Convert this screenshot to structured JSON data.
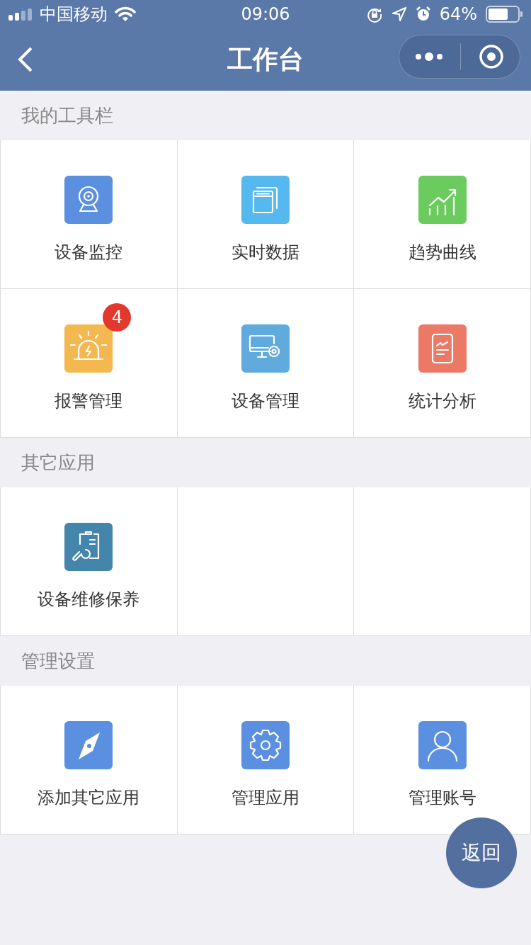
{
  "status_bar": {
    "carrier": "中国移动",
    "time": "09:06",
    "battery": "64%"
  },
  "nav": {
    "title": "工作台"
  },
  "sections": [
    {
      "title": "我的工具栏",
      "items": [
        {
          "label": "设备监控",
          "color": "#5b8fe0"
        },
        {
          "label": "实时数据",
          "color": "#55b8ee"
        },
        {
          "label": "趋势曲线",
          "color": "#6ccb5f"
        },
        {
          "label": "报警管理",
          "color": "#f3b84f",
          "badge": "4"
        },
        {
          "label": "设备管理",
          "color": "#60aadd"
        },
        {
          "label": "统计分析",
          "color": "#ec7866"
        }
      ]
    },
    {
      "title": "其它应用",
      "items": [
        {
          "label": "设备维修保养",
          "color": "#4485ab"
        }
      ]
    },
    {
      "title": "管理设置",
      "items": [
        {
          "label": "添加其它应用",
          "color": "#5b8fe0"
        },
        {
          "label": "管理应用",
          "color": "#5b8fe0"
        },
        {
          "label": "管理账号",
          "color": "#5b8fe0"
        }
      ]
    }
  ],
  "float_button": {
    "label": "返回"
  }
}
